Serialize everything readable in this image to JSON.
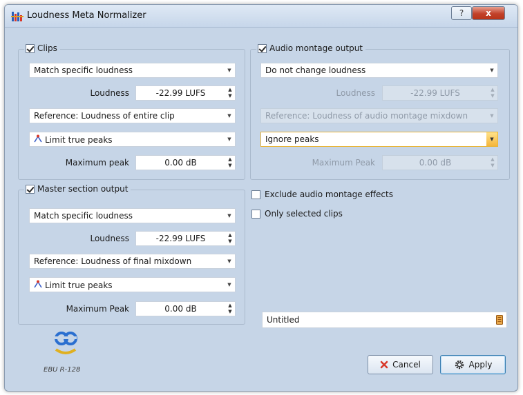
{
  "window": {
    "title": "Loudness Meta Normalizer",
    "help_label": "?",
    "close_label": "x"
  },
  "clips": {
    "label": "Clips",
    "checked": true,
    "mode": "Match specific loudness",
    "loudness_label": "Loudness",
    "loudness_value": "-22.99 LUFS",
    "reference": "Reference: Loudness of entire clip",
    "peak_mode": "Limit true peaks",
    "max_peak_label": "Maximum peak",
    "max_peak_value": "0.00 dB"
  },
  "montage": {
    "label": "Audio montage output",
    "checked": true,
    "mode": "Do not change loudness",
    "loudness_label": "Loudness",
    "loudness_value": "-22.99 LUFS",
    "reference": "Reference: Loudness of audio montage mixdown",
    "peak_mode": "Ignore peaks",
    "max_peak_label": "Maximum Peak",
    "max_peak_value": "0.00 dB"
  },
  "master": {
    "label": "Master section output",
    "checked": true,
    "mode": "Match specific loudness",
    "loudness_label": "Loudness",
    "loudness_value": "-22.99 LUFS",
    "reference": "Reference: Loudness of final mixdown",
    "peak_mode": "Limit true peaks",
    "max_peak_label": "Maximum Peak",
    "max_peak_value": "0.00 dB"
  },
  "options": {
    "exclude_effects": "Exclude audio montage effects",
    "exclude_effects_checked": false,
    "only_selected": "Only selected clips",
    "only_selected_checked": false
  },
  "preset": {
    "name": "Untitled"
  },
  "buttons": {
    "cancel": "Cancel",
    "apply": "Apply"
  },
  "logo": {
    "text": "EBU R-128"
  },
  "icons": {
    "app": "loudness-normalizer-icon",
    "peak": "true-peak-icon",
    "preset": "preset-save-icon",
    "cancel": "cancel-x-icon",
    "apply": "apply-gear-icon",
    "logo": "ebu-r128-logo"
  }
}
